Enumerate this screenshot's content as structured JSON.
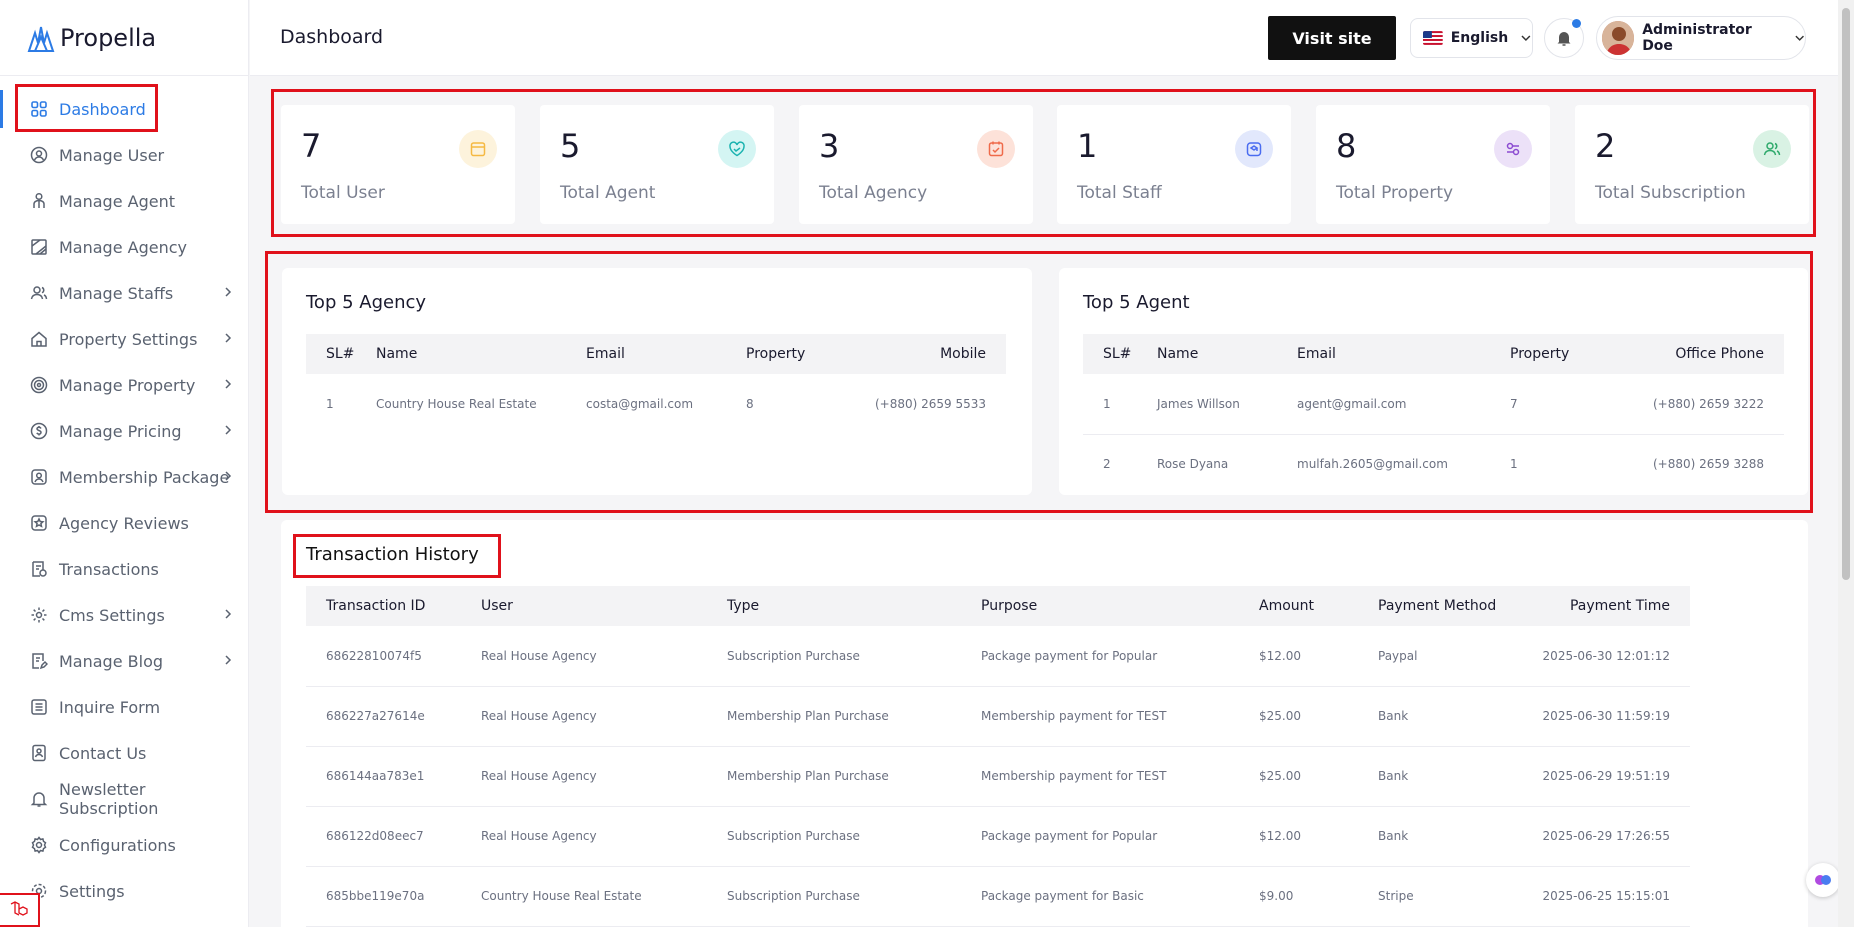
{
  "brand": {
    "name": "Propella"
  },
  "header": {
    "title": "Dashboard",
    "visit_site": "Visit site",
    "language": "English",
    "user_name": "Administrator Doe"
  },
  "sidebar": {
    "items": [
      {
        "label": "Dashboard",
        "icon": "grid-icon"
      },
      {
        "label": "Manage User",
        "icon": "user-icon"
      },
      {
        "label": "Manage Agent",
        "icon": "agent-icon"
      },
      {
        "label": "Manage Agency",
        "icon": "building-icon"
      },
      {
        "label": "Manage Staffs",
        "icon": "users-icon"
      },
      {
        "label": "Property Settings",
        "icon": "home-icon"
      },
      {
        "label": "Manage Property",
        "icon": "settings-icon"
      },
      {
        "label": "Manage Pricing",
        "icon": "dollar-icon"
      },
      {
        "label": "Membership Package",
        "icon": "badge-icon"
      },
      {
        "label": "Agency Reviews",
        "icon": "star-icon"
      },
      {
        "label": "Transactions",
        "icon": "receipt-icon"
      },
      {
        "label": "Cms Settings",
        "icon": "gear-icon"
      },
      {
        "label": "Manage Blog",
        "icon": "edit-icon"
      },
      {
        "label": "Inquire Form",
        "icon": "list-icon"
      },
      {
        "label": "Contact Us",
        "icon": "contact-icon"
      },
      {
        "label": "Newsletter Subscription",
        "icon": "bell-icon"
      },
      {
        "label": "Configurations",
        "icon": "cog-icon"
      },
      {
        "label": "Settings",
        "icon": "gear-icon"
      }
    ]
  },
  "stats": [
    {
      "value": "7",
      "label": "Total User",
      "color": "#f5b942",
      "bg": "#fdf3dc"
    },
    {
      "value": "5",
      "label": "Total Agent",
      "color": "#1bb3b0",
      "bg": "#d4f5f3"
    },
    {
      "value": "3",
      "label": "Total Agency",
      "color": "#ef6a4a",
      "bg": "#fde2d9"
    },
    {
      "value": "1",
      "label": "Total Staff",
      "color": "#4a6cf0",
      "bg": "#e2e8fc"
    },
    {
      "value": "8",
      "label": "Total Property",
      "color": "#8b4ad1",
      "bg": "#ece1f8"
    },
    {
      "value": "2",
      "label": "Total Subscription",
      "color": "#2ea96b",
      "bg": "#d9f2e4"
    }
  ],
  "top_agency": {
    "title": "Top 5 Agency",
    "headers": [
      "SL#",
      "Name",
      "Email",
      "Property",
      "Mobile"
    ],
    "rows": [
      [
        "1",
        "Country House Real Estate",
        "costa@gmail.com",
        "8",
        "(+880) 2659 5533"
      ]
    ]
  },
  "top_agent": {
    "title": "Top 5 Agent",
    "headers": [
      "SL#",
      "Name",
      "Email",
      "Property",
      "Office Phone"
    ],
    "rows": [
      [
        "1",
        "James Willson",
        "agent@gmail.com",
        "7",
        "(+880) 2659 3222"
      ],
      [
        "2",
        "Rose Dyana",
        "mulfah.2605@gmail.com",
        "1",
        "(+880) 2659 3288"
      ]
    ]
  },
  "transactions": {
    "title": "Transaction History",
    "headers": [
      "Transaction ID",
      "User",
      "Type",
      "Purpose",
      "Amount",
      "Payment Method",
      "Payment Time"
    ],
    "rows": [
      [
        "68622810074f5",
        "Real House Agency",
        "Subscription Purchase",
        "Package payment for Popular",
        "$12.00",
        "Paypal",
        "2025-06-30 12:01:12"
      ],
      [
        "686227a27614e",
        "Real House Agency",
        "Membership Plan Purchase",
        "Membership payment for TEST",
        "$25.00",
        "Bank",
        "2025-06-30 11:59:19"
      ],
      [
        "686144aa783e1",
        "Real House Agency",
        "Membership Plan Purchase",
        "Membership payment for TEST",
        "$25.00",
        "Bank",
        "2025-06-29 19:51:19"
      ],
      [
        "686122d08eec7",
        "Real House Agency",
        "Subscription Purchase",
        "Package payment for Popular",
        "$12.00",
        "Bank",
        "2025-06-29 17:26:55"
      ],
      [
        "685bbe119e70a",
        "Country House Real Estate",
        "Subscription Purchase",
        "Package payment for Basic",
        "$9.00",
        "Stripe",
        "2025-06-25 15:15:01"
      ]
    ]
  }
}
